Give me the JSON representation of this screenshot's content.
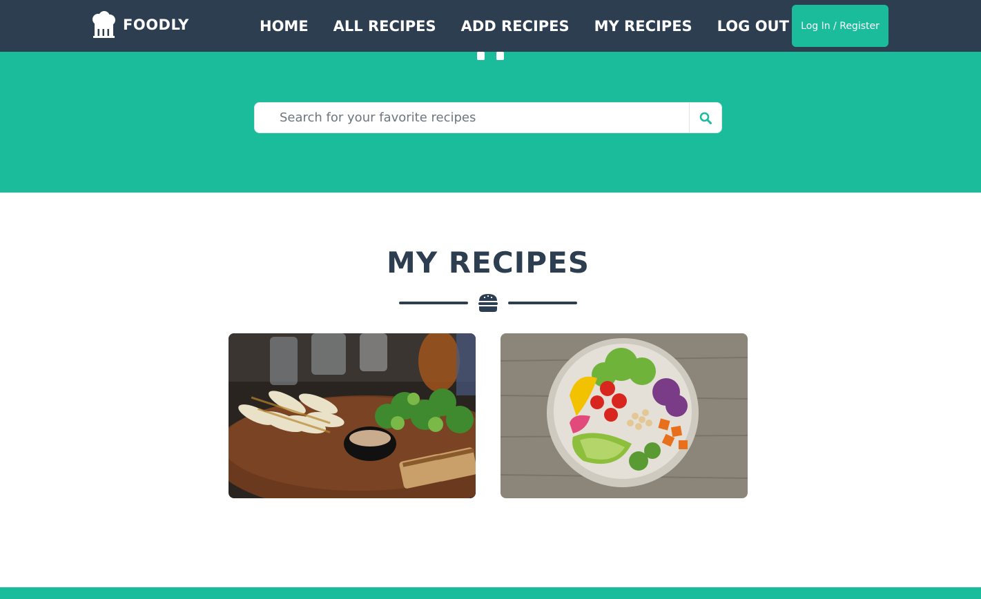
{
  "brand": {
    "name": "FOODLY",
    "icon": "chef-hat-icon"
  },
  "nav": {
    "items": [
      {
        "label": "HOME"
      },
      {
        "label": "ALL RECIPES"
      },
      {
        "label": "ADD RECIPES"
      },
      {
        "label": "MY RECIPES"
      },
      {
        "label": "LOG OUT"
      }
    ],
    "login_label": "Log In / Register"
  },
  "search": {
    "placeholder": "Search for your favorite recipes",
    "value": "",
    "button_icon": "search-icon"
  },
  "section": {
    "title": "MY RECIPES",
    "divider_icon": "hamburger-icon"
  },
  "recipes": [
    {
      "image": "grilled-fish-platter-image"
    },
    {
      "image": "vegetable-salad-bowl-image"
    }
  ],
  "colors": {
    "navbar": "#2c3e50",
    "accent": "#1abc9c",
    "heading": "#2c3e50",
    "page_background": "#ffffff"
  }
}
